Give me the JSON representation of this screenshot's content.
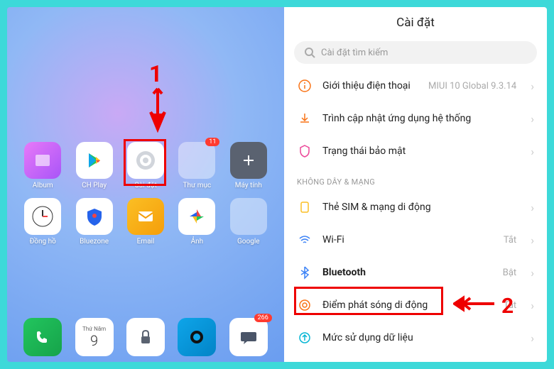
{
  "annotations": {
    "step1": "1",
    "step2": "2"
  },
  "left": {
    "apps_row1": [
      {
        "label": "Album",
        "badge": null
      },
      {
        "label": "CH Play",
        "badge": null
      },
      {
        "label": "Cài đặt",
        "badge": null
      },
      {
        "label": "Thư mục",
        "badge": "11"
      },
      {
        "label": "Máy tính",
        "badge": null
      }
    ],
    "apps_row2": [
      {
        "label": "Đồng hồ",
        "badge": null
      },
      {
        "label": "Bluezone",
        "badge": null
      },
      {
        "label": "Email",
        "badge": null
      },
      {
        "label": "Ảnh",
        "badge": null
      },
      {
        "label": "Google",
        "badge": null
      }
    ],
    "calendar": {
      "day": "Thứ Năm",
      "date": "9"
    },
    "dock_badge": "266"
  },
  "right": {
    "title": "Cài đặt",
    "search_placeholder": "Cài đặt tìm kiếm",
    "block1": [
      {
        "title": "Giới thiệu điện thoại",
        "value": "MIUI 10 Global 9.3.14"
      },
      {
        "title": "Trình cập nhật ứng dụng hệ thống",
        "value": ""
      },
      {
        "title": "Trạng thái bảo mật",
        "value": ""
      }
    ],
    "section": "KHÔNG DÂY & MẠNG",
    "block2": [
      {
        "title": "Thẻ SIM & mạng di động",
        "value": ""
      },
      {
        "title": "Wi-Fi",
        "value": "Tắt"
      },
      {
        "title": "Bluetooth",
        "value": "Bật"
      },
      {
        "title": "Điểm phát sóng di động",
        "value": "Tắt"
      },
      {
        "title": "Mức sử dụng dữ liệu",
        "value": ""
      }
    ]
  }
}
